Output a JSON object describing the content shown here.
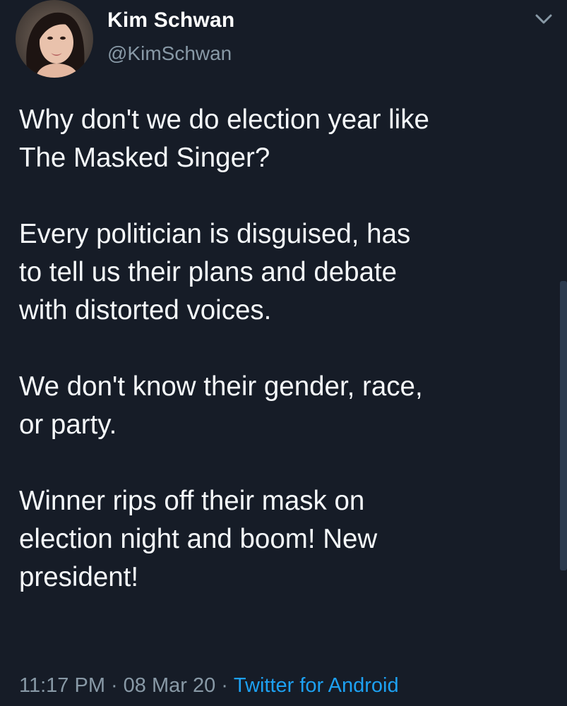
{
  "author": {
    "display_name": "Kim Schwan",
    "handle": "@KimSchwan"
  },
  "icons": {
    "menu": "chevron-down-icon",
    "avatar": "profile-photo"
  },
  "tweet": {
    "lines": [
      [
        "Why don't we do election year like",
        "The Masked Singer?"
      ],
      [
        "Every politician is disguised, has",
        "to tell us their plans and debate",
        "with distorted voices."
      ],
      [
        "We don't know their gender, race,",
        "or party."
      ],
      [
        "Winner rips off their mask on",
        "election night and boom! New",
        "president!"
      ]
    ]
  },
  "meta": {
    "time": "11:17 PM",
    "separator": "·",
    "date": "08 Mar 20",
    "source": "Twitter for Android"
  },
  "colors": {
    "background": "#161c27",
    "text": "#f5f8fa",
    "secondary_text": "#8899a6",
    "link": "#1da1f2"
  }
}
